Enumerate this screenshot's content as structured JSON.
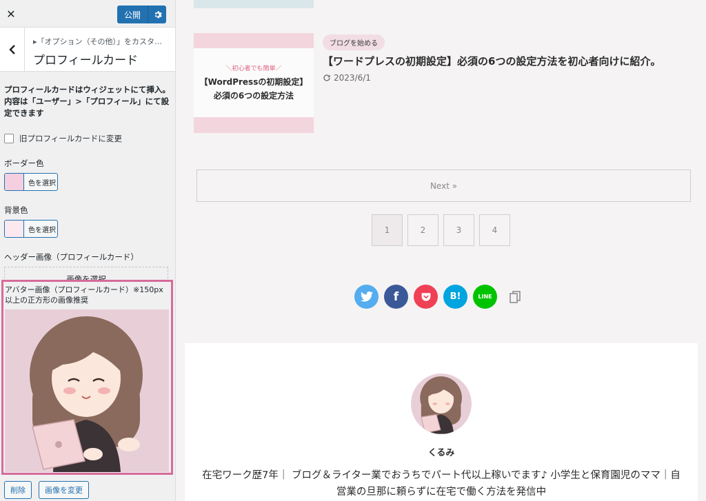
{
  "topbar": {
    "close_icon": "close-icon",
    "publish_label": "公開",
    "settings_icon": "gear-icon"
  },
  "section": {
    "breadcrumb": "▸「オプション（その他）」をカスタ…",
    "title": "プロフィールカード"
  },
  "panel": {
    "description": "プロフィールカードはウィジェットにて挿入。内容は「ユーザー」>「プロフィール」にて設定できます",
    "legacy_checkbox_label": "旧プロフィールカードに変更",
    "legacy_checked": false,
    "border_color_label": "ボーダー色",
    "border_color_value": "#f5cfe0",
    "bg_color_label": "背景色",
    "bg_color_value": "#fbe9ef",
    "select_color_label": "色を選択",
    "header_image_label": "ヘッダー画像（プロフィールカード）",
    "select_image_label": "画像を選択",
    "avatar_label": "アバター画像（プロフィールカード）※150px以上の正方形の画像推奨",
    "delete_label": "削除",
    "change_image_label": "画像を変更"
  },
  "post": {
    "thumb_small": "＼初心者でも簡単／",
    "thumb_line1": "【WordPressの初期設定】",
    "thumb_line2": "必須の6つの設定方法",
    "category": "ブログを始める",
    "title": "【ワードプレスの初期設定】必須の6つの設定方法を初心者向けに紹介。",
    "date": "2023/6/1"
  },
  "pagination": {
    "next_label": "Next »",
    "pages": [
      "1",
      "2",
      "3",
      "4"
    ],
    "current": "1"
  },
  "share": [
    {
      "name": "twitter",
      "color": "#55acee"
    },
    {
      "name": "facebook",
      "color": "#3b5998"
    },
    {
      "name": "pocket",
      "color": "#ef4056"
    },
    {
      "name": "hatena",
      "color": "#00a4de",
      "text": "B!"
    },
    {
      "name": "line",
      "color": "#00c300"
    },
    {
      "name": "copy",
      "color": "#f5f3f4"
    }
  ],
  "profile": {
    "name": "くるみ",
    "bio": "在宅ワーク歴7年｜ ブログ＆ライター業でおうちでパート代以上稼いでます♪ 小学生と保育園児のママ｜自営業の旦那に頼らずに在宅で働く方法を発信中"
  }
}
